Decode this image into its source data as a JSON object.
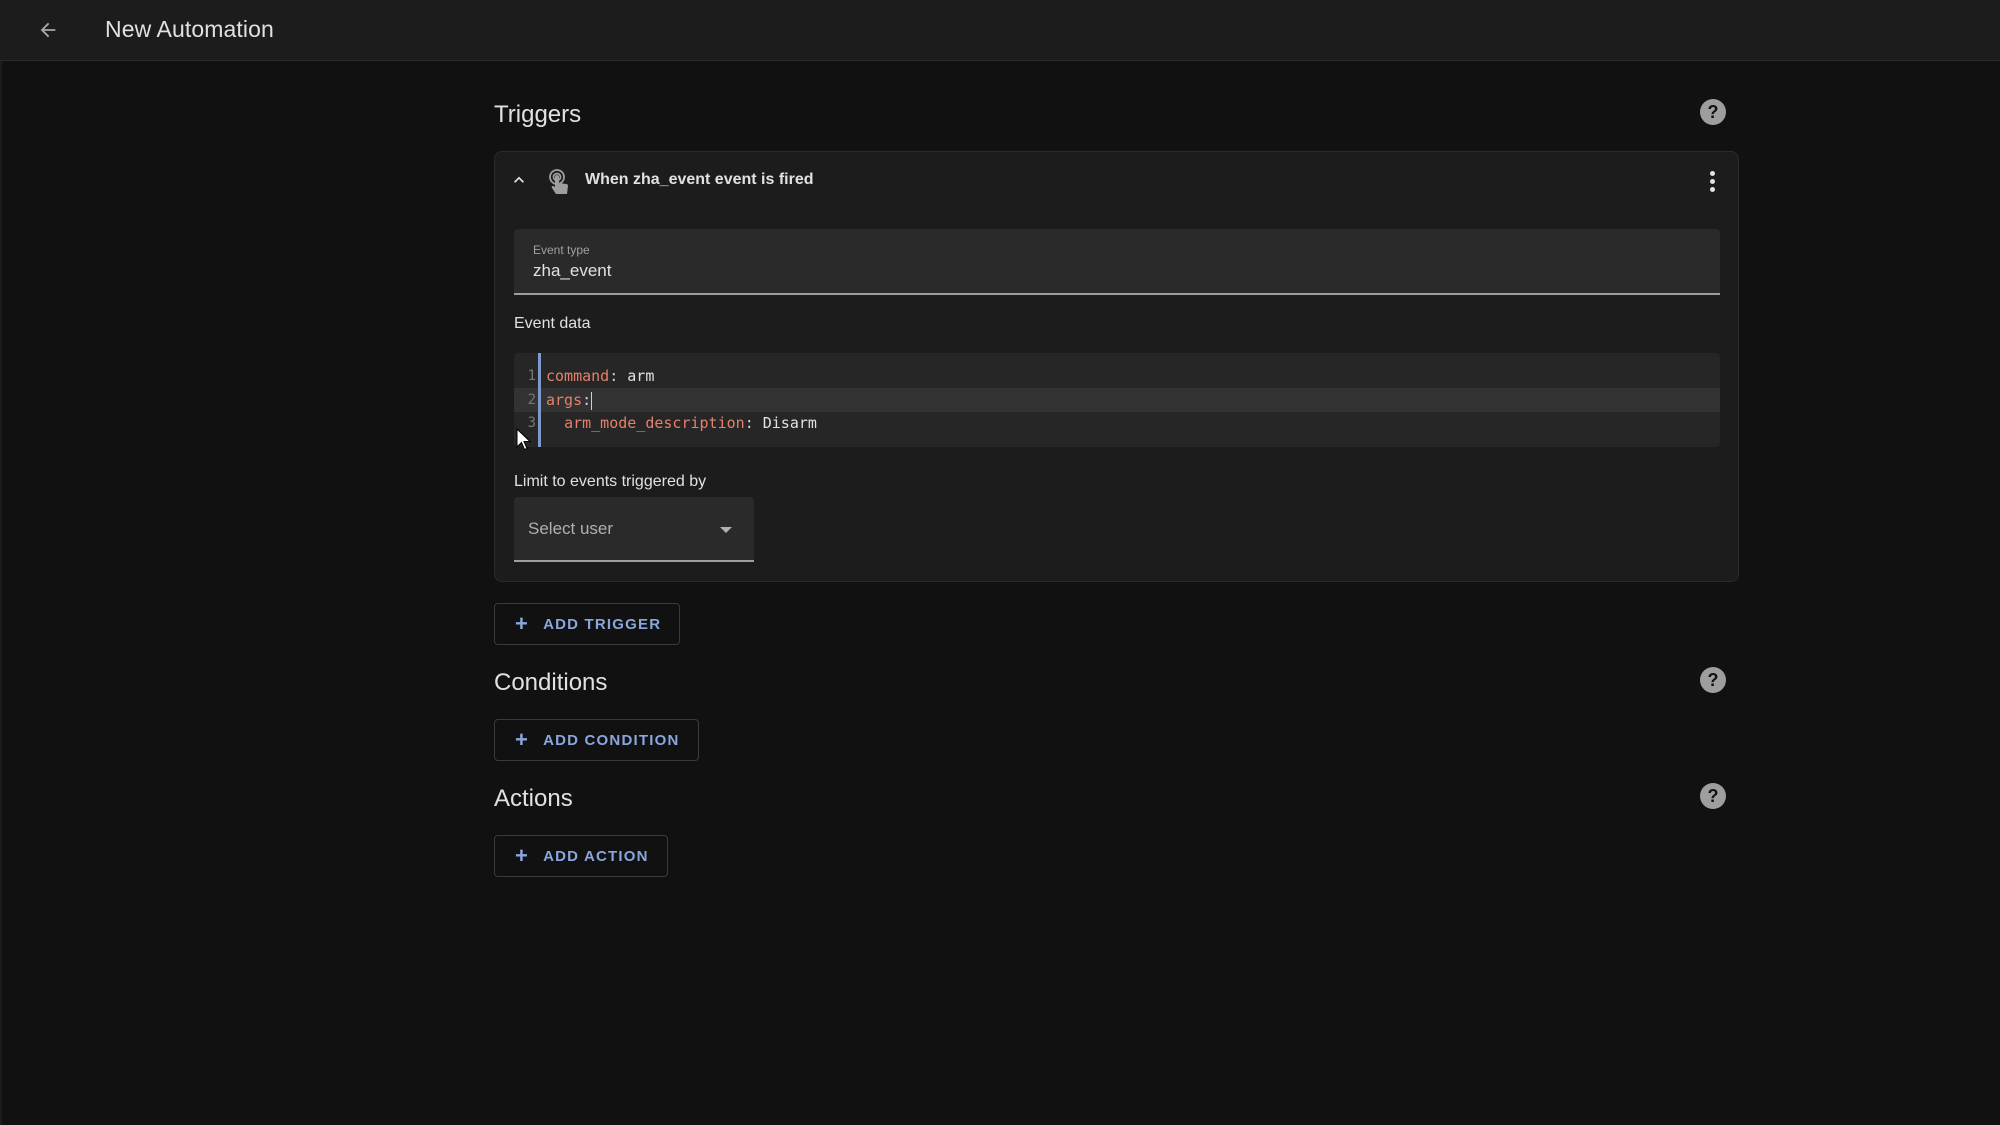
{
  "header": {
    "back_icon": "arrow-left-icon",
    "title": "New Automation"
  },
  "triggers": {
    "title": "Triggers",
    "help_icon": "help-circle-icon",
    "help_glyph": "?",
    "card": {
      "collapse_icon": "chevron-up-icon",
      "trigger_icon": "gesture-tap-icon",
      "title": "When zha_event event is fired",
      "overflow_icon": "dots-vertical-icon",
      "event_type": {
        "label": "Event type",
        "value": "zha_event"
      },
      "event_data": {
        "label": "Event data",
        "lines": [
          {
            "num": "1",
            "key": "command",
            "sep": ": ",
            "value": "arm",
            "indent": ""
          },
          {
            "num": "2",
            "key": "args",
            "sep": ":",
            "value": "",
            "indent": ""
          },
          {
            "num": "3",
            "key": "arm_mode_description",
            "sep": ": ",
            "value": "Disarm",
            "indent": "  "
          }
        ]
      },
      "limit": {
        "label": "Limit to events triggered by",
        "placeholder": "Select user",
        "caret_icon": "menu-down-icon"
      }
    },
    "add_button": {
      "icon": "plus-icon",
      "glyph": "+",
      "label": "ADD TRIGGER"
    }
  },
  "conditions": {
    "title": "Conditions",
    "help_glyph": "?",
    "add_button": {
      "icon": "plus-icon",
      "glyph": "+",
      "label": "ADD CONDITION"
    }
  },
  "actions": {
    "title": "Actions",
    "help_glyph": "?",
    "add_button": {
      "icon": "plus-icon",
      "glyph": "+",
      "label": "ADD ACTION"
    }
  },
  "colors": {
    "background": "#111111",
    "topbar": "#1c1c1c",
    "card": "#1c1c1c",
    "field": "#2a2a2a",
    "accent_button_text": "#8aa6dd",
    "yaml_key": "#e5806b",
    "editor_gutter_bar": "#7f99cc"
  }
}
